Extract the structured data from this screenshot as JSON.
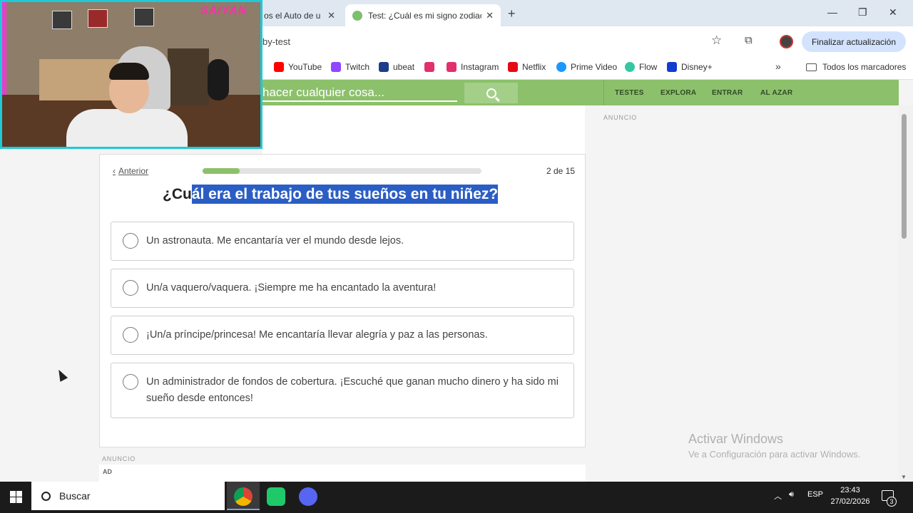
{
  "browser": {
    "tabs": [
      {
        "title": "os el Auto de u",
        "active": false
      },
      {
        "title": "Test: ¿Cuál es mi signo zodiacal",
        "active": true
      }
    ],
    "new_tab_icon": "+",
    "window_controls": {
      "minimize": "—",
      "restore": "❐",
      "close": "✕"
    },
    "url_fragment": "by-test",
    "update_button": "Finalizar actualización",
    "bookmarks": [
      {
        "label": "YouTube",
        "color": "#ff0000"
      },
      {
        "label": "Twitch",
        "color": "#9146ff"
      },
      {
        "label": "ubeat",
        "color": "#1c3d8c"
      },
      {
        "label": "",
        "color": "#e1306c"
      },
      {
        "label": "Instagram",
        "color": "#e1306c"
      },
      {
        "label": "Netflix",
        "color": "#e50914"
      },
      {
        "label": "Prime Video",
        "color": "#1a98ff"
      },
      {
        "label": "Flow",
        "color": "#35c8a0"
      },
      {
        "label": "Disney+",
        "color": "#113ccf"
      }
    ],
    "bookmarks_more": "»",
    "all_bookmarks": "Todos los marcadores"
  },
  "site": {
    "search_placeholder": "hacer cualquier cosa...",
    "nav": [
      "TESTES",
      "EXPLORA",
      "ENTRAR",
      "AL AZAR"
    ],
    "accent_color": "#8cc06b"
  },
  "quiz": {
    "prev_label": "Anterior",
    "counter": "2 de 15",
    "progress_fraction": 0.133,
    "question_plain": "¿Cu",
    "question_highlighted": "ál era el trabajo de tus sueños en tu niñez?",
    "options": [
      {
        "text": "Un astronauta. Me encantaría ver el mundo desde lejos."
      },
      {
        "text": "Un/a vaquero/vaquera. ¡Siempre me ha encantado la aventura!"
      },
      {
        "text": "¡Un/a príncipe/princesa! Me encantaría llevar alegría y paz a las personas."
      },
      {
        "text": "Un administrador de fondos de cobertura. ¡Escuché que ganan mucho dinero y ha sido mi sueño desde entonces!"
      }
    ]
  },
  "ads": {
    "label": "ANUNCIO",
    "tag": "AD"
  },
  "watermark": {
    "title": "Activar Windows",
    "subtitle": "Ve a Configuración para activar Windows."
  },
  "webcam": {
    "brand_text": "SAIYAN"
  },
  "taskbar": {
    "search_label": "Buscar",
    "language": "ESP",
    "time": "23:43",
    "date": "27/02/2026",
    "notification_count": "3"
  }
}
